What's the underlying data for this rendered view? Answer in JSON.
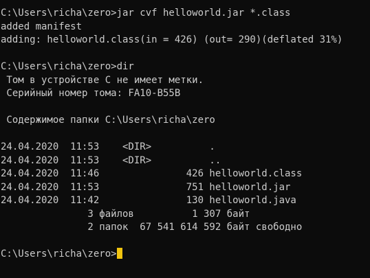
{
  "terminal": {
    "lines": [
      "C:\\Users\\richa\\zero>jar cvf helloworld.jar *.class",
      "added manifest",
      "adding: helloworld.class(in = 426) (out= 290)(deflated 31%)",
      "",
      "C:\\Users\\richa\\zero>dir",
      " Том в устройстве C не имеет метки.",
      " Серийный номер тома: FA10-B55B",
      "",
      " Содержимое папки C:\\Users\\richa\\zero",
      "",
      "24.04.2020  11:53    <DIR>          .",
      "24.04.2020  11:53    <DIR>          ..",
      "24.04.2020  11:46               426 helloworld.class",
      "24.04.2020  11:53               751 helloworld.jar",
      "24.04.2020  11:42               130 helloworld.java",
      "               3 файлов          1 307 байт",
      "               2 папок  67 541 614 592 байт свободно",
      ""
    ],
    "prompt": "C:\\Users\\richa\\zero>",
    "cursor_color": "#f1c40f",
    "text_color": "#cccccc",
    "background_color": "#0c0c0c"
  }
}
